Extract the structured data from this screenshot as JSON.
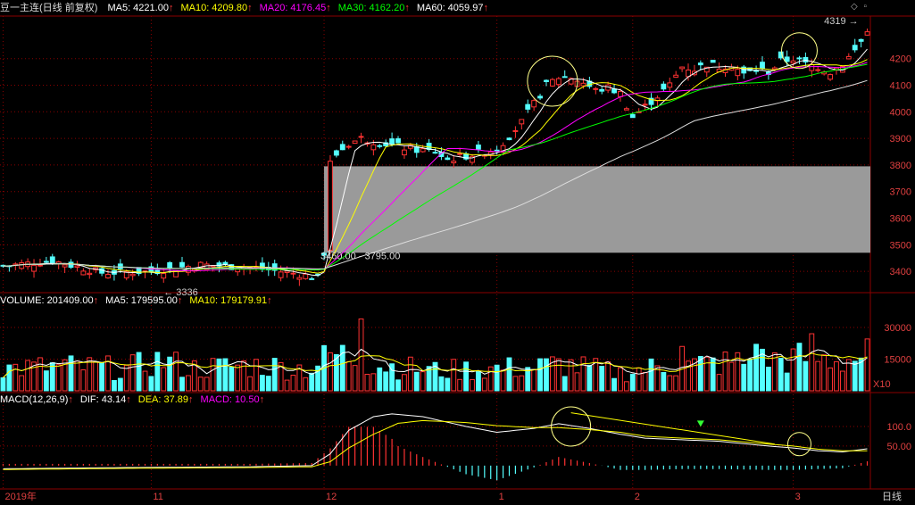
{
  "header": {
    "title": "豆一主连(日线 前复权)",
    "ma": [
      {
        "label": "MA5: 4221.00",
        "color": "#ffffff"
      },
      {
        "label": "MA10: 4209.80",
        "color": "#ffff00"
      },
      {
        "label": "MA20: 4176.45",
        "color": "#ff00ff"
      },
      {
        "label": "MA30: 4162.20",
        "color": "#00ff00"
      },
      {
        "label": "MA60: 4059.97",
        "color": "#ffffff"
      }
    ]
  },
  "volume_header": {
    "items": [
      {
        "label": "VOLUME: 201409.00",
        "color": "#ffffff"
      },
      {
        "label": "MA5: 179595.00",
        "color": "#ffffff"
      },
      {
        "label": "MA10: 179179.91",
        "color": "#ffff00"
      }
    ]
  },
  "macd_header": {
    "items": [
      {
        "label": "MACD(12,26,9)",
        "color": "#ffffff"
      },
      {
        "label": "DIF: 43.14",
        "color": "#ffffff"
      },
      {
        "label": "DEA: 37.89",
        "color": "#ffff00"
      },
      {
        "label": "MACD: 10.50",
        "color": "#ff00ff"
      }
    ]
  },
  "period_label": "日线",
  "volume_scale": "X10",
  "icons": [
    "diamond-icon",
    "square-icon"
  ],
  "colors": {
    "up": "#ff3232",
    "down": "#54ffff",
    "grid": "#8b0000",
    "box": "#9a9a9a"
  },
  "chart_data": {
    "type": "candlestick",
    "price_axis": {
      "ticks": [
        3400,
        3500,
        3600,
        3700,
        3800,
        3900,
        4000,
        4100,
        4200
      ],
      "ylim": [
        3330,
        4360
      ]
    },
    "volume_axis": {
      "ticks": [
        "15000",
        "30000"
      ],
      "ylim": [
        0,
        38000
      ]
    },
    "macd_axis": {
      "ticks": [
        "50.00",
        "100.0"
      ],
      "ylim": [
        -55,
        150
      ]
    },
    "x_labels": [
      {
        "label": "2019年",
        "index": 0
      },
      {
        "label": "11",
        "index": 24
      },
      {
        "label": "12",
        "index": 52
      },
      {
        "label": "1",
        "index": 80
      },
      {
        "label": "2",
        "index": 102
      },
      {
        "label": "3",
        "index": 128
      }
    ],
    "annotations": {
      "high_label": "4319",
      "low_label": "3336",
      "range_label": "3460.00 - 3795.00",
      "range_box": [
        3470,
        3795
      ]
    },
    "ohlc_anchors": [
      [
        0,
        3420
      ],
      [
        8,
        3440
      ],
      [
        16,
        3395
      ],
      [
        24,
        3400
      ],
      [
        32,
        3425
      ],
      [
        40,
        3415
      ],
      [
        48,
        3390
      ],
      [
        51,
        3375
      ],
      [
        52,
        3470
      ],
      [
        53,
        3820
      ],
      [
        56,
        3880
      ],
      [
        58,
        3900
      ],
      [
        62,
        3880
      ],
      [
        66,
        3860
      ],
      [
        70,
        3850
      ],
      [
        72,
        3820
      ],
      [
        76,
        3840
      ],
      [
        80,
        3860
      ],
      [
        84,
        3960
      ],
      [
        88,
        4100
      ],
      [
        90,
        4130
      ],
      [
        92,
        4130
      ],
      [
        94,
        4110
      ],
      [
        96,
        4080
      ],
      [
        98,
        4090
      ],
      [
        100,
        4070
      ],
      [
        102,
        3980
      ],
      [
        104,
        4020
      ],
      [
        106,
        4060
      ],
      [
        108,
        4100
      ],
      [
        110,
        4170
      ],
      [
        112,
        4160
      ],
      [
        114,
        4180
      ],
      [
        116,
        4170
      ],
      [
        118,
        4180
      ],
      [
        120,
        4140
      ],
      [
        122,
        4160
      ],
      [
        124,
        4150
      ],
      [
        126,
        4190
      ],
      [
        128,
        4200
      ],
      [
        130,
        4180
      ],
      [
        132,
        4170
      ],
      [
        134,
        4150
      ],
      [
        136,
        4180
      ],
      [
        138,
        4230
      ],
      [
        140,
        4300
      ]
    ],
    "volume_anchors": [
      [
        0,
        10500
      ],
      [
        10,
        11500
      ],
      [
        20,
        10500
      ],
      [
        26,
        14500
      ],
      [
        30,
        10500
      ],
      [
        40,
        12000
      ],
      [
        50,
        10500
      ],
      [
        53,
        17000
      ],
      [
        56,
        16500
      ],
      [
        60,
        12500
      ],
      [
        70,
        9500
      ],
      [
        80,
        10500
      ],
      [
        86,
        11000
      ],
      [
        90,
        12500
      ],
      [
        100,
        8500
      ],
      [
        104,
        10500
      ],
      [
        110,
        12000
      ],
      [
        116,
        13000
      ],
      [
        124,
        14500
      ],
      [
        130,
        15500
      ],
      [
        136,
        14500
      ],
      [
        140,
        16500
      ]
    ],
    "dif_anchors": [
      [
        0,
        -8
      ],
      [
        20,
        -5
      ],
      [
        40,
        -3
      ],
      [
        50,
        0
      ],
      [
        53,
        30
      ],
      [
        56,
        90
      ],
      [
        60,
        125
      ],
      [
        63,
        132
      ],
      [
        68,
        125
      ],
      [
        75,
        100
      ],
      [
        80,
        85
      ],
      [
        86,
        95
      ],
      [
        90,
        107
      ],
      [
        95,
        95
      ],
      [
        100,
        80
      ],
      [
        104,
        70
      ],
      [
        110,
        66
      ],
      [
        116,
        62
      ],
      [
        124,
        50
      ],
      [
        128,
        45
      ],
      [
        132,
        38
      ],
      [
        136,
        35
      ],
      [
        140,
        43
      ]
    ],
    "dea_anchors": [
      [
        0,
        -10
      ],
      [
        20,
        -7
      ],
      [
        40,
        -5
      ],
      [
        50,
        -3
      ],
      [
        53,
        10
      ],
      [
        56,
        45
      ],
      [
        60,
        80
      ],
      [
        64,
        108
      ],
      [
        68,
        115
      ],
      [
        75,
        110
      ],
      [
        80,
        102
      ],
      [
        86,
        97
      ],
      [
        90,
        97
      ],
      [
        95,
        92
      ],
      [
        100,
        85
      ],
      [
        104,
        75
      ],
      [
        110,
        70
      ],
      [
        116,
        66
      ],
      [
        124,
        55
      ],
      [
        128,
        50
      ],
      [
        132,
        42
      ],
      [
        136,
        38
      ],
      [
        140,
        38
      ]
    ]
  }
}
